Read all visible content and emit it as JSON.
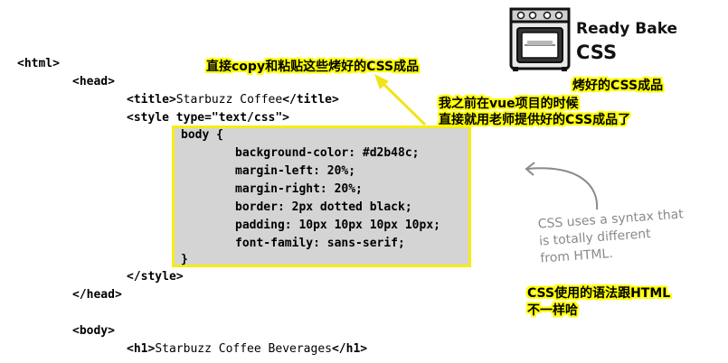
{
  "code": {
    "l1": "<html>",
    "l2": "<head>",
    "l3_open": "<title>",
    "l3_text": "Starbuzz Coffee",
    "l3_close": "</title>",
    "l4": "<style type=\"text/css\">",
    "css": [
      "body {",
      "background-color: #d2b48c;",
      "margin-left: 20%;",
      "margin-right: 20%;",
      "border: 2px dotted black;",
      "padding: 10px 10px 10px 10px;",
      "font-family: sans-serif;",
      "}"
    ],
    "l5": "</style>",
    "l6": "</head>",
    "l7": "<body>",
    "l8_open": "<h1>",
    "l8_text": "Starbuzz Coffee Beverages",
    "l8_close": "</h1>"
  },
  "annotations": {
    "copy_paste": "直接copy和粘贴这些烤好的CSS成品",
    "vue_line1": "我之前在vue项目的时候",
    "vue_line2": "直接就用老师提供好的CSS成品了",
    "baked_css": "烤好的CSS成品",
    "syntax_line1": "CSS使用的语法跟HTML",
    "syntax_line2": "不一样哈"
  },
  "handwritten_note": {
    "line1": "CSS uses a syntax that",
    "line2": "is totally different",
    "line3": "from HTML."
  },
  "logo": {
    "line1": "Ready Bake",
    "line2": "CSS"
  },
  "colors": {
    "highlight": "#ffff00",
    "css_box_bg": "#d4d4d4",
    "css_box_border": "#f7ec12",
    "arrow": "#f2e31a",
    "note": "#8a8a8a"
  }
}
